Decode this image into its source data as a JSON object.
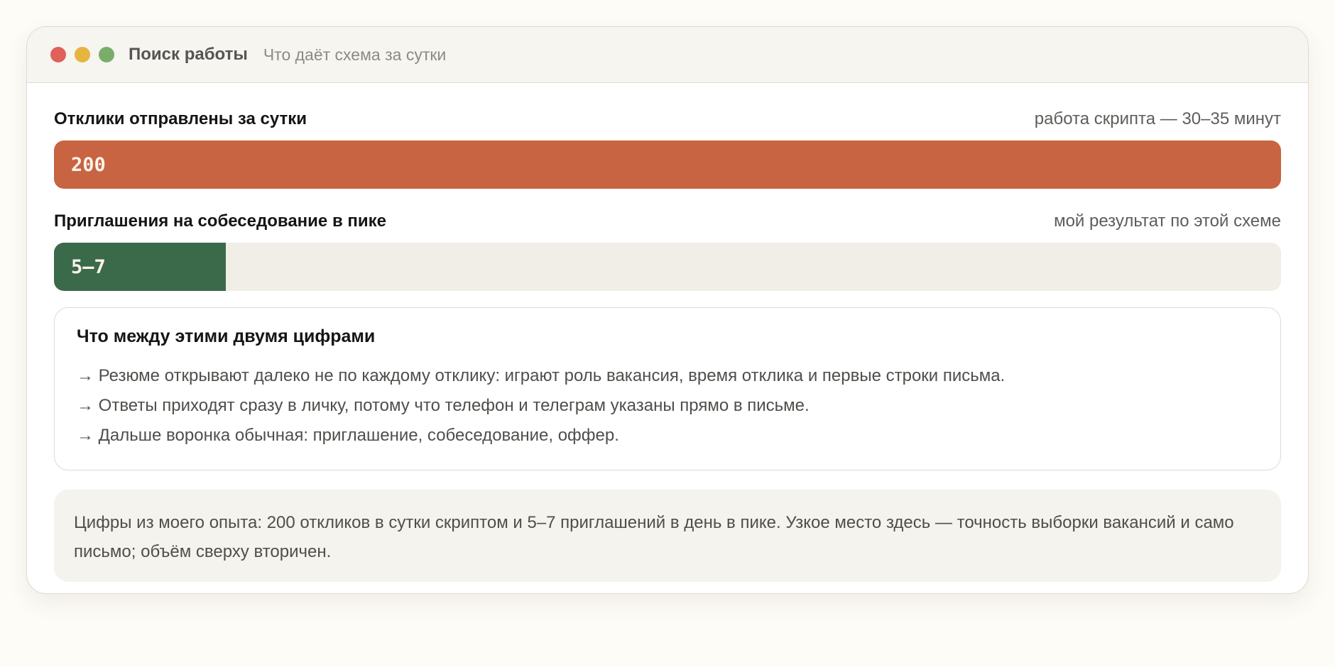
{
  "window": {
    "title": "Поиск работы",
    "subtitle": "Что даёт схема за сутки",
    "controls": {
      "close_color": "#e0605a",
      "minimize_color": "#e5b53f",
      "zoom_color": "#78ad6a"
    }
  },
  "metrics": [
    {
      "label": "Отклики отправлены за сутки",
      "note": "работа скрипта — 30–35 минут",
      "value": "200",
      "fill_fraction": 1.0,
      "color": "#c86442"
    },
    {
      "label": "Приглашения на собеседование в пике",
      "note": "мой результат по этой схеме",
      "value": "5–7",
      "fill_fraction": 0.14,
      "color": "#3b6a4b"
    }
  ],
  "explain": {
    "title": "Что между этими двумя цифрами",
    "items": [
      "→ Резюме открывают далеко не по каждому отклику: играют роль вакансия, время отклика и первые строки письма.",
      "→ Ответы приходят сразу в личку, потому что телефон и телеграм указаны прямо в письме.",
      "→ Дальше воронка обычная: приглашение, собеседование, оффер."
    ]
  },
  "footer_note": "Цифры из моего опыта: 200 откликов в сутки скриптом и 5–7 приглашений в день в пике. Узкое место здесь — точность выборки вакансий и само письмо; объём сверху вторичен."
}
